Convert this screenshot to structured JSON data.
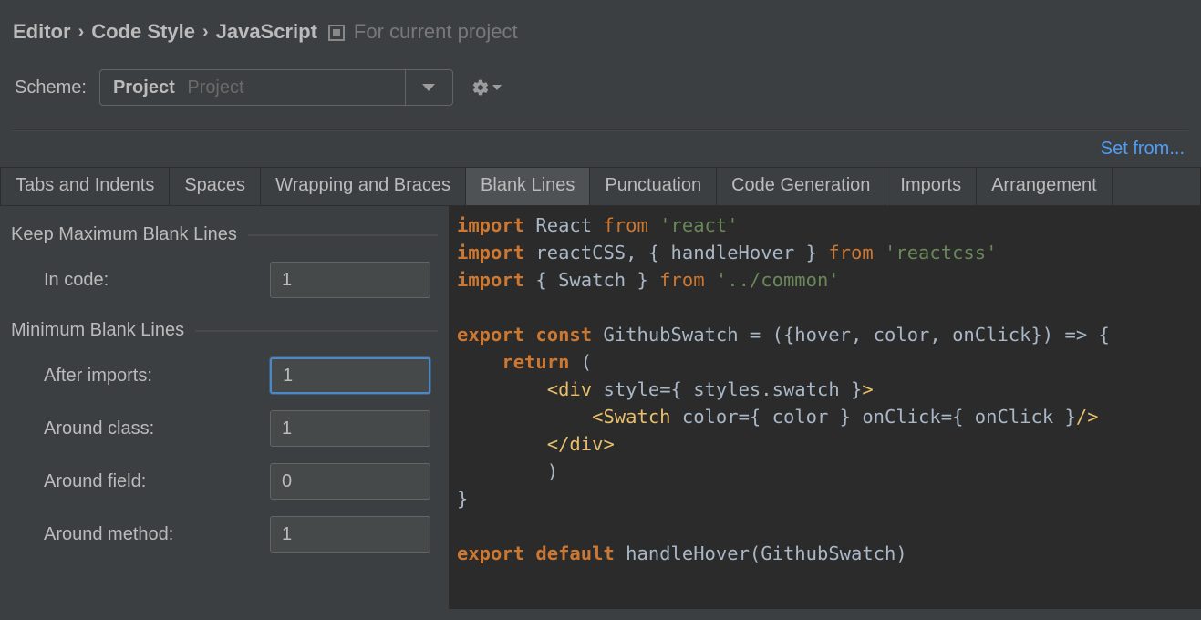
{
  "breadcrumb": {
    "a": "Editor",
    "b": "Code Style",
    "c": "JavaScript",
    "scope": "For current project"
  },
  "scheme": {
    "label": "Scheme:",
    "value": "Project",
    "hint": "Project"
  },
  "setfrom": "Set from...",
  "tabs": [
    "Tabs and Indents",
    "Spaces",
    "Wrapping and Braces",
    "Blank Lines",
    "Punctuation",
    "Code Generation",
    "Imports",
    "Arrangement"
  ],
  "active_tab": 3,
  "sections": {
    "keep": {
      "title": "Keep Maximum Blank Lines",
      "fields": [
        {
          "label": "In code:",
          "value": "1"
        }
      ]
    },
    "min": {
      "title": "Minimum Blank Lines",
      "fields": [
        {
          "label": "After imports:",
          "value": "1",
          "focused": true
        },
        {
          "label": "Around class:",
          "value": "1"
        },
        {
          "label": "Around field:",
          "value": "0"
        },
        {
          "label": "Around method:",
          "value": "1"
        }
      ]
    }
  },
  "code": {
    "l1a": "import",
    "l1b": " React ",
    "l1c": "from ",
    "l1d": "'react'",
    "l2a": "import",
    "l2b": " reactCSS, { handleHover } ",
    "l2c": "from ",
    "l2d": "'reactcss'",
    "l3a": "import",
    "l3b": " { Swatch } ",
    "l3c": "from ",
    "l3d": "'../common'",
    "l5a": "export ",
    "l5b": "const ",
    "l5c": "GithubSwatch = ({hover, color, onClick}) => {",
    "l6a": "    ",
    "l6b": "return ",
    "l6c": "(",
    "l7a": "        ",
    "l7b": "<div ",
    "l7c": "style",
    "l7d": "={ styles.swatch }",
    "l7e": ">",
    "l8a": "            ",
    "l8b": "<Swatch ",
    "l8c": "color",
    "l8d": "={ color } ",
    "l8e": "onClick",
    "l8f": "={ onClick }",
    "l8g": "/>",
    "l9a": "        ",
    "l9b": "</div>",
    "l10": "    )",
    "l11": "}",
    "l13a": "export ",
    "l13b": "default ",
    "l13c": "handleHover(GithubSwatch)"
  }
}
